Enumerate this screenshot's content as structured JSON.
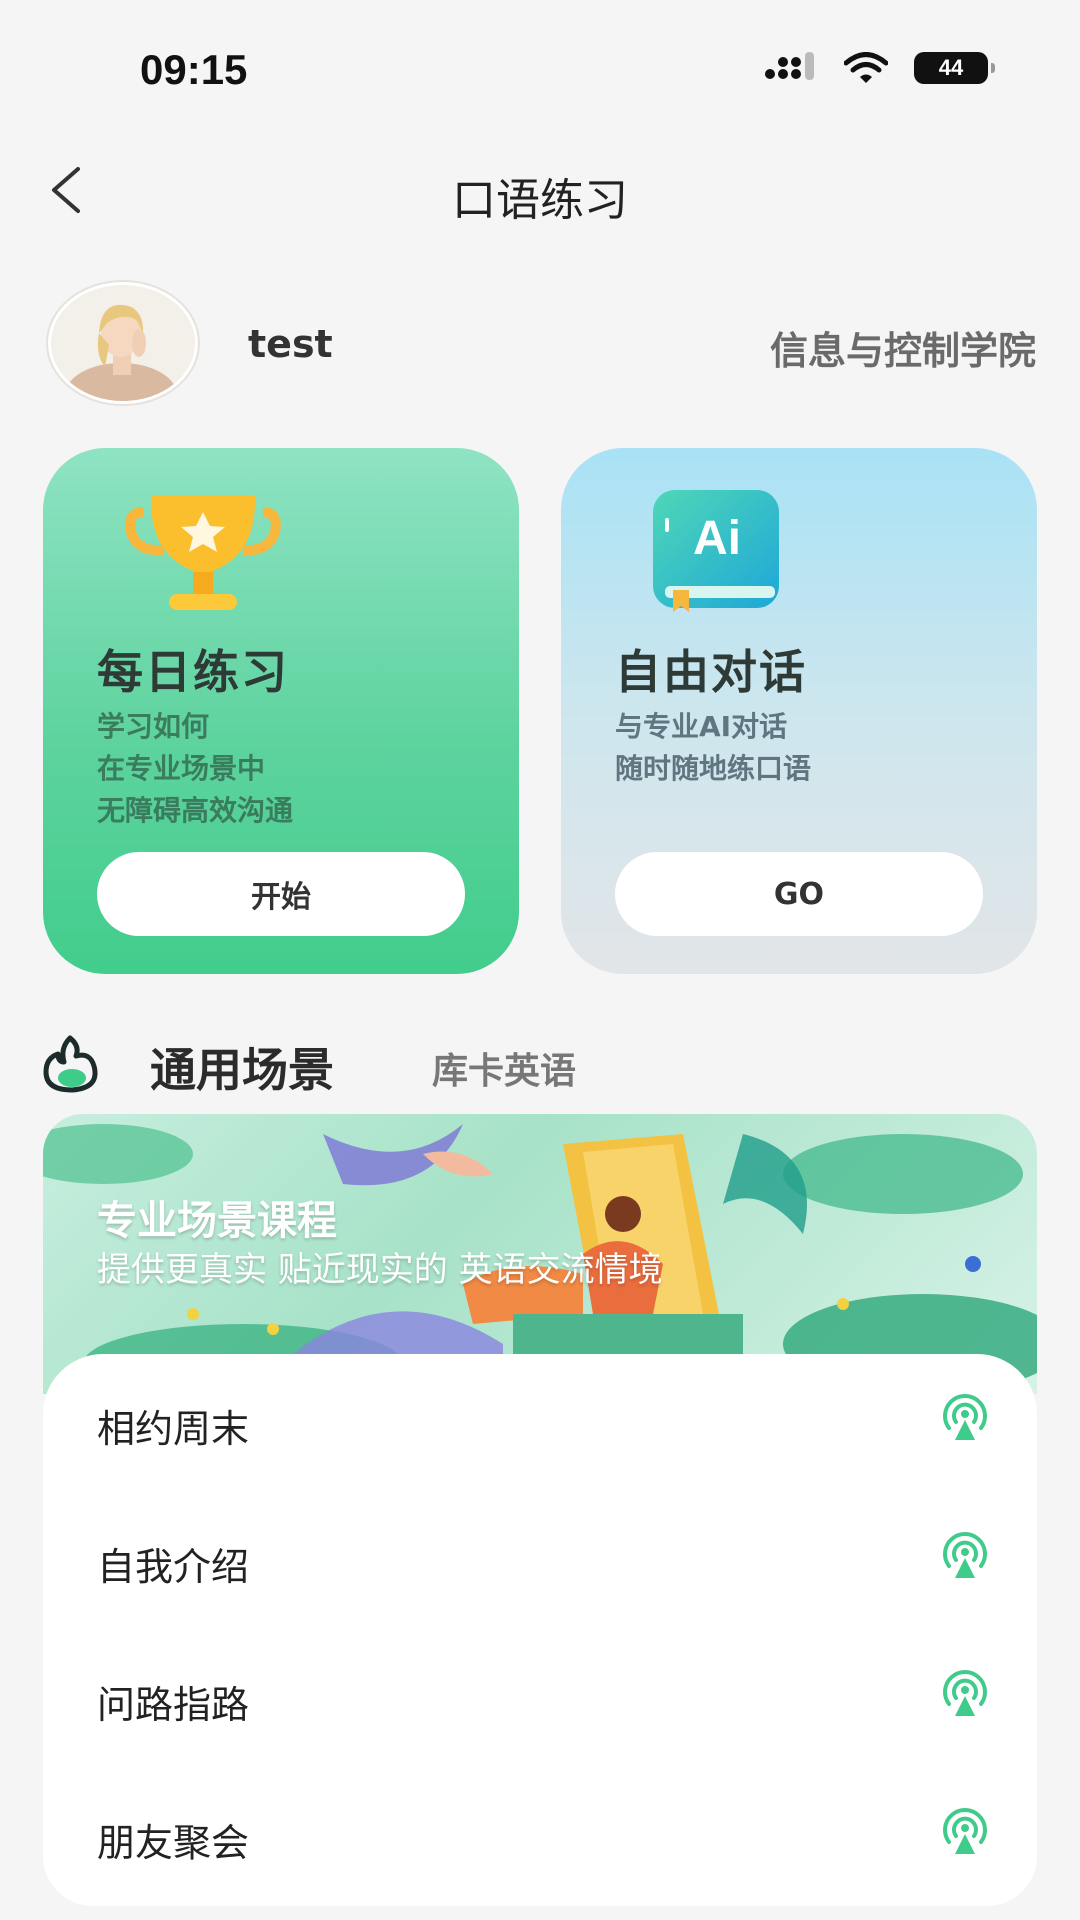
{
  "status_bar": {
    "time": "09:15",
    "battery": "44",
    "icons": [
      "signal-icon",
      "wifi-icon",
      "battery-icon"
    ]
  },
  "nav": {
    "title": "口语练习",
    "back_icon": "chevron-left-icon"
  },
  "profile": {
    "username": "test",
    "school": "信息与控制学院"
  },
  "cards": [
    {
      "title": "每日练习",
      "desc": [
        "学习如何",
        "在专业场景中",
        "无障碍高效沟通"
      ],
      "button": "开始",
      "icon": "trophy-icon"
    },
    {
      "title": "自由对话",
      "desc": [
        "与专业AI对话",
        "随时随地练口语"
      ],
      "button": "GO",
      "icon": "ai-book-icon",
      "icon_text": "Ai"
    }
  ],
  "section": {
    "title": "通用场景",
    "subtitle": "库卡英语"
  },
  "banner": {
    "title": "专业场景课程",
    "subtitle": "提供更真实 贴近现实的 英语交流情境"
  },
  "scenes": [
    {
      "label": "相约周末",
      "icon": "broadcast-icon"
    },
    {
      "label": "自我介绍",
      "icon": "broadcast-icon"
    },
    {
      "label": "问路指路",
      "icon": "broadcast-icon"
    },
    {
      "label": "朋友聚会",
      "icon": "broadcast-icon"
    }
  ],
  "colors": {
    "accent_green": "#3fcb8a",
    "card_green_top": "#8fe3c3",
    "card_blue_top": "#a9e2f5",
    "background": "#f5f5f6"
  }
}
